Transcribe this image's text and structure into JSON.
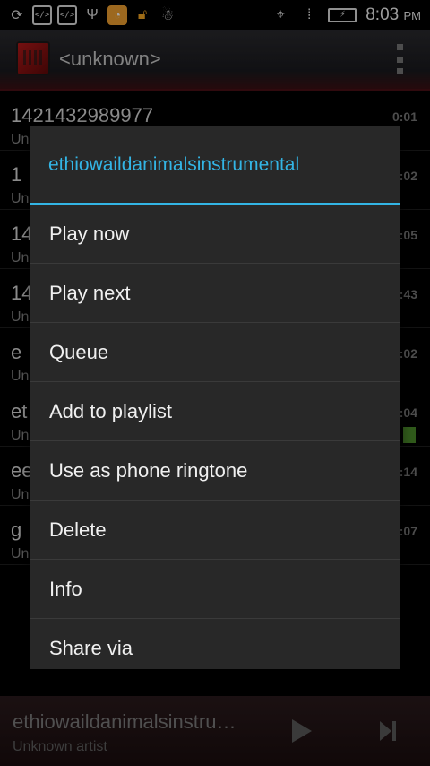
{
  "status_bar": {
    "time": "8:03",
    "ampm": "PM",
    "icons": [
      "sync-icon",
      "code-icon",
      "code-icon",
      "usb-icon",
      "cleaner-icon",
      "unlock-icon",
      "android-icon",
      "gps-icon",
      "no-signal-icon",
      "battery-charging-icon"
    ]
  },
  "app_bar": {
    "title": "<unknown>"
  },
  "songs": [
    {
      "title": "1421432989977",
      "artist": "Unknown artist",
      "duration": "0:01"
    },
    {
      "title": "1",
      "artist": "Unknown artist",
      "duration": "0:02"
    },
    {
      "title": "14",
      "artist": "Unknown artist",
      "duration": "0:05"
    },
    {
      "title": "14",
      "artist": "Unknown artist",
      "duration": "2:43"
    },
    {
      "title": "e",
      "artist": "Unknown artist",
      "duration": "0:02"
    },
    {
      "title": "et",
      "artist": "Unknown artist",
      "duration": "0:04"
    },
    {
      "title": "ee",
      "artist": "Unknown artist",
      "duration": "0:14"
    },
    {
      "title": "g",
      "artist": "Unknown artist",
      "duration": "0:07"
    }
  ],
  "now_playing": {
    "title": "ethiowaildanimalsinstru…",
    "artist": "Unknown artist"
  },
  "dialog": {
    "title": "ethiowaildanimalsinstrumental",
    "items": [
      "Play now",
      "Play next",
      "Queue",
      "Add to playlist",
      "Use as phone ringtone",
      "Delete",
      "Info",
      "Share via"
    ]
  },
  "colors": {
    "accent": "#33b5e5",
    "dialog_bg": "#282828"
  }
}
